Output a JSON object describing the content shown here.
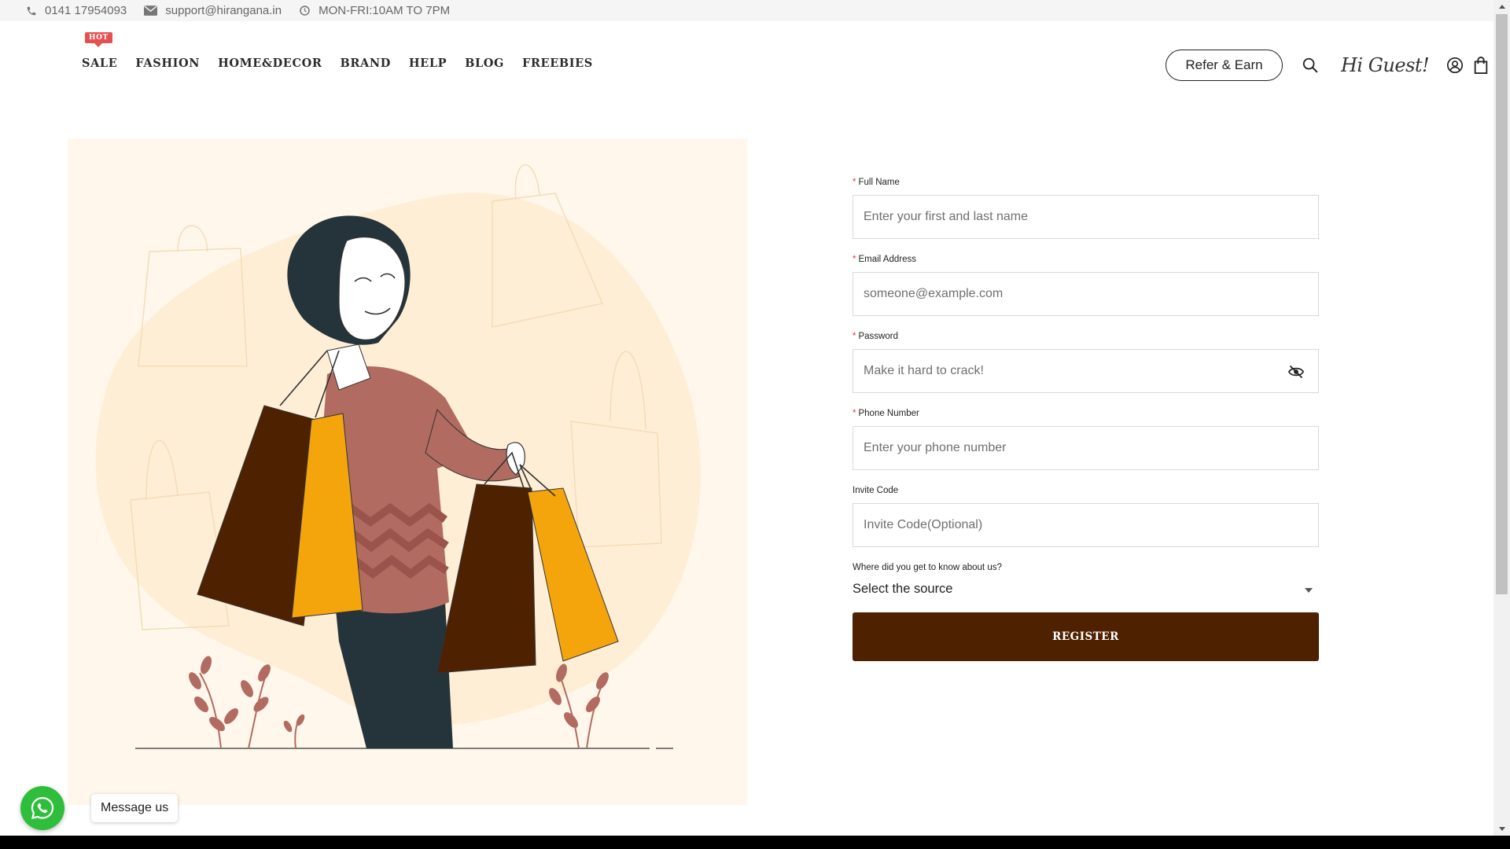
{
  "topbar": {
    "phone": "0141 17954093",
    "email": "support@hirangana.in",
    "hours": "MON-FRI:10AM TO 7PM"
  },
  "nav": {
    "items": [
      {
        "label": "SALE",
        "badge": "HOT"
      },
      {
        "label": "FASHION"
      },
      {
        "label": "HOME&DECOR"
      },
      {
        "label": "BRAND"
      },
      {
        "label": "HELP"
      },
      {
        "label": "BLOG"
      },
      {
        "label": "FREEBIES"
      }
    ]
  },
  "header": {
    "refer_label": "Refer & Earn",
    "greeting": "Hi Guest!",
    "icons": [
      "search-icon",
      "user-icon",
      "bag-icon"
    ]
  },
  "form": {
    "full_name": {
      "label": "Full Name",
      "required": true,
      "placeholder": "Enter your first and last name"
    },
    "email": {
      "label": "Email Address",
      "required": true,
      "placeholder": "someone@example.com"
    },
    "password": {
      "label": "Password",
      "required": true,
      "placeholder": "Make it hard to crack!"
    },
    "phone": {
      "label": "Phone Number",
      "required": true,
      "placeholder": "Enter your phone number"
    },
    "invite": {
      "label": "Invite Code",
      "required": false,
      "placeholder": "Invite Code(Optional)"
    },
    "source": {
      "label": "Where did you get to know about us?",
      "selected": "Select the source"
    },
    "submit_label": "REGISTER",
    "required_marker": "*"
  },
  "whatsapp": {
    "message": "Message us"
  },
  "colors": {
    "brand_brown": "#4e2100",
    "accent_orange": "#f5a50c",
    "hot_red": "#e55050",
    "illustration_bg": "#fff7ec",
    "whatsapp_green": "#2fbe3b"
  }
}
